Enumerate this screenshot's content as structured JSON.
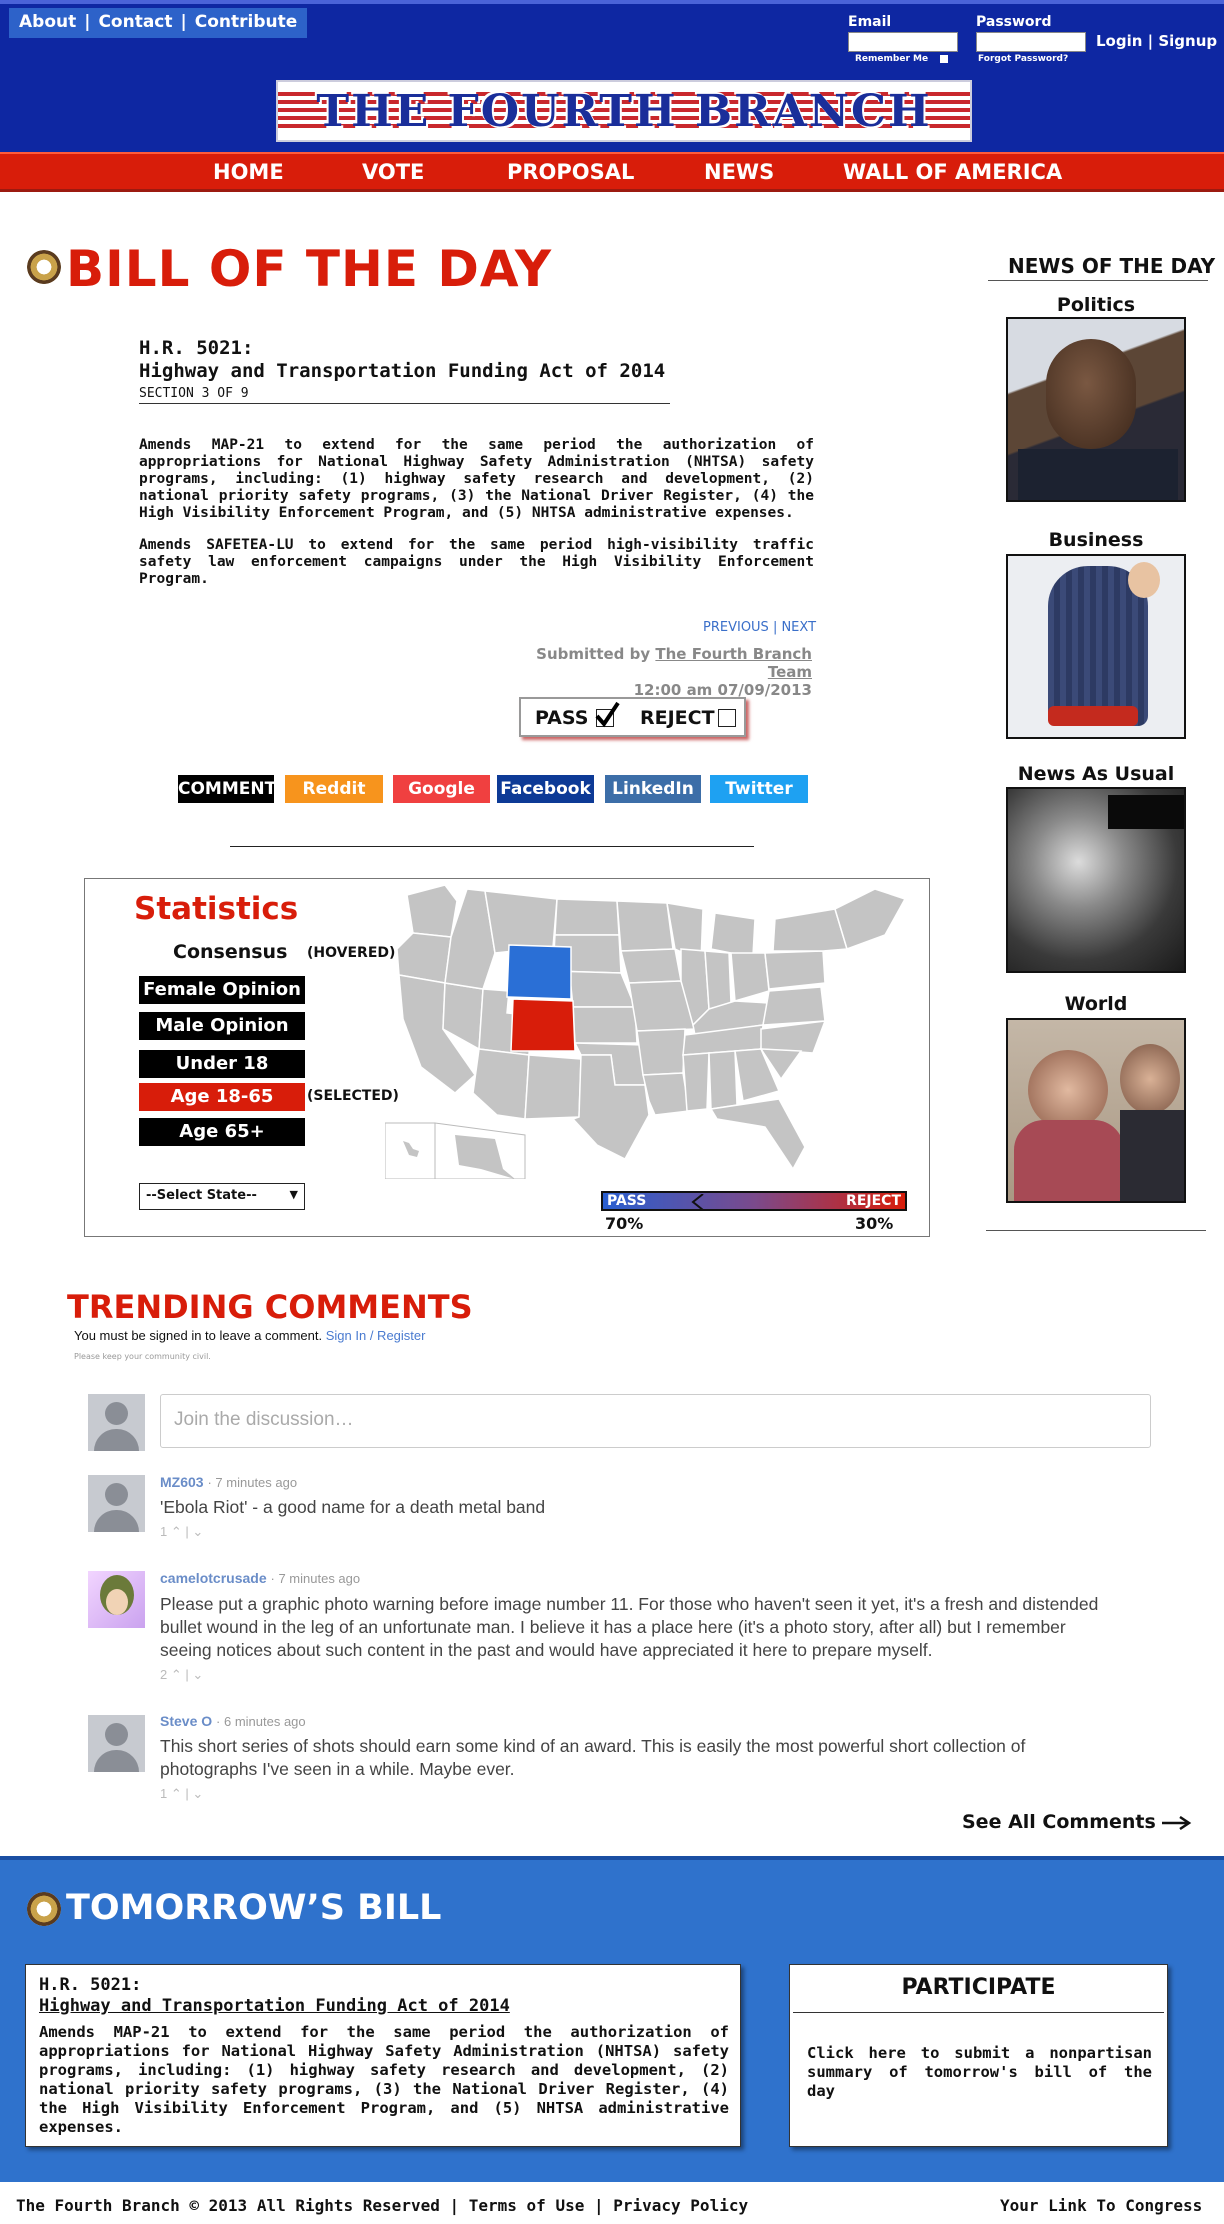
{
  "header": {
    "top_links": [
      "About",
      "Contact",
      "Contribute"
    ],
    "email_label": "Email",
    "password_label": "Password",
    "remember_me": "Remember Me",
    "forgot_password": "Forgot Password?",
    "login_signup": "Login | Signup",
    "logo_text": "THE FOURTH BRANCH"
  },
  "nav": {
    "items": [
      "HOME",
      "VOTE",
      "PROPOSAL",
      "NEWS",
      "WALL OF AMERICA"
    ]
  },
  "bill": {
    "heading": "BILL OF THE DAY",
    "number": "H.R. 5021:",
    "name": "Highway and Transportation Funding Act of 2014",
    "section": "SECTION 3 OF 9",
    "paragraph1": "Amends MAP-21 to extend for the same period the authorization of appropriations for National Highway Safety Administration (NHTSA) safety programs, including: (1) highway safety research and development, (2) national priority safety programs, (3) the National Driver Register, (4) the High Visibility Enforcement Program, and (5) NHTSA administrative expenses.",
    "paragraph2": "Amends SAFETEA-LU to extend for the same period high-visibility traffic safety law enforcement campaigns under the High Visibility Enforcement Program.",
    "prev_next": "PREVIOUS | NEXT",
    "submitted_prefix": "Submitted by",
    "submitted_by": "The Fourth Branch Team",
    "submitted_time": "12:00 am 07/09/2013",
    "pass_label": "PASS",
    "reject_label": "REJECT",
    "pass_checked": true,
    "reject_checked": false
  },
  "share": {
    "buttons": [
      {
        "label": "COMMENT",
        "color": "#000000"
      },
      {
        "label": "Reddit",
        "color": "#f7941d"
      },
      {
        "label": "Google",
        "color": "#f04040"
      },
      {
        "label": "Facebook",
        "color": "#0d3a96"
      },
      {
        "label": "LinkedIn",
        "color": "#3c6ea8"
      },
      {
        "label": "Twitter",
        "color": "#1ea1f2"
      }
    ]
  },
  "stats": {
    "title": "Statistics",
    "consensus": "Consensus",
    "hovered_tag": "(HOVERED)",
    "selected_tag": "(SELECTED)",
    "options": [
      "Female Opinion",
      "Male Opinion",
      "Under 18",
      "Age 18-65",
      "Age 65+"
    ],
    "selected_option": "Age 18-65",
    "select_state": "--Select State--",
    "pass_label": "PASS",
    "reject_label": "REJECT",
    "pass_percent": "70%",
    "reject_percent": "30%",
    "hovered_color": "#2a6fd6",
    "selected_color": "#d81d0a"
  },
  "sidebar": {
    "heading": "NEWS OF THE DAY",
    "categories": [
      "Politics",
      "Business",
      "News As Usual",
      "World"
    ]
  },
  "comments": {
    "heading": "TRENDING COMMENTS",
    "signin_prefix": "You must be signed in to leave a comment.",
    "signin_link": "Sign In / Register",
    "civil_note": "Please keep your community civil.",
    "placeholder": "Join the discussion…",
    "items": [
      {
        "user": "MZ603",
        "time": "7 minutes ago",
        "text": "'Ebola Riot' - a good name for a death metal band",
        "votes": "1"
      },
      {
        "user": "camelotcrusade",
        "time": "7 minutes ago",
        "text": "Please put a graphic photo warning before image number 11. For those who haven't seen it yet, it's a fresh and distended bullet wound in the leg of an unfortunate man. I believe it has a place here (it's a photo story, after all) but I remember seeing notices about such content in the past and would have appreciated it here to prepare myself.",
        "votes": "2"
      },
      {
        "user": "Steve O",
        "time": "6 minutes ago",
        "text": "This short series of shots should earn some kind of an award. This is easily the most powerful short collection of photographs I've seen in a while. Maybe ever.",
        "votes": "1"
      }
    ],
    "see_all": "See All Comments"
  },
  "tomorrow": {
    "heading": "TOMORROW’S BILL",
    "number": "H.R. 5021:",
    "name": "Highway and Transportation Funding Act of 2014",
    "summary": "Amends MAP-21 to extend for the same period the authorization of appropriations for National Highway Safety Administration (NHTSA) safety programs, including: (1) highway safety research and development, (2) national priority safety programs, (3) the National Driver Register, (4) the High Visibility Enforcement Program, and (5) NHTSA administrative expenses.",
    "participate_title": "PARTICIPATE",
    "participate_text": "Click here to submit a nonpartisan summary of tomorrow's bill of the day"
  },
  "footer": {
    "left": "The Fourth Branch © 2013 All Rights Reserved | Terms of Use | Privacy Policy",
    "right": "Your Link To Congress"
  }
}
